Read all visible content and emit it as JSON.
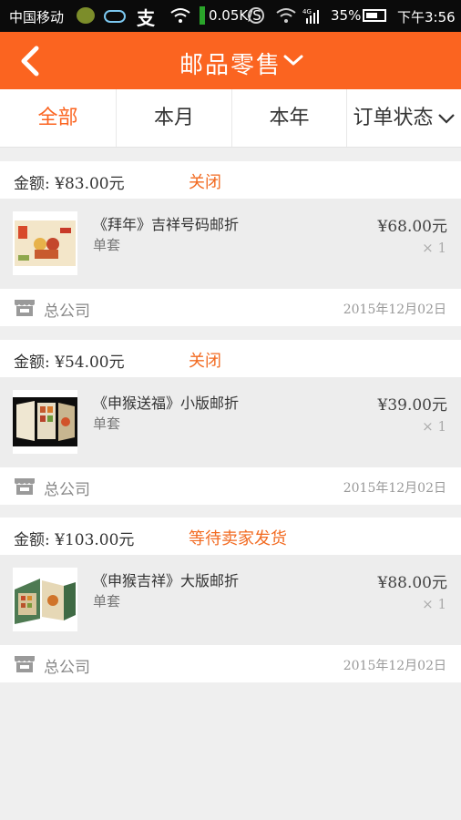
{
  "status_bar": {
    "carrier": "中国移动",
    "speed": "0.05K/S",
    "network": "4G",
    "battery": "35%",
    "time": "下午3:56"
  },
  "header": {
    "title": "邮品零售",
    "background": "#fb6420"
  },
  "tabs": [
    {
      "label": "全部",
      "active": true
    },
    {
      "label": "本月",
      "active": false
    },
    {
      "label": "本年",
      "active": false
    },
    {
      "label": "订单状态",
      "active": false
    }
  ],
  "orders": [
    {
      "amount": "金额: ¥83.00元",
      "status": "关闭",
      "item_name": "《拜年》吉祥号码邮折",
      "item_spec": "单套",
      "price": "¥68.00元",
      "qty": "× 1",
      "shop": "总公司",
      "date": "2015年12月02日"
    },
    {
      "amount": "金额: ¥54.00元",
      "status": "关闭",
      "item_name": "《申猴送福》小版邮折",
      "item_spec": "单套",
      "price": "¥39.00元",
      "qty": "× 1",
      "shop": "总公司",
      "date": "2015年12月02日"
    },
    {
      "amount": "金额: ¥103.00元",
      "status": "等待卖家发货",
      "item_name": "《申猴吉祥》大版邮折",
      "item_spec": "单套",
      "price": "¥88.00元",
      "qty": "× 1",
      "shop": "总公司",
      "date": "2015年12月02日"
    }
  ],
  "colors": {
    "accent": "#fb6420",
    "status_text": "#f26b22"
  }
}
